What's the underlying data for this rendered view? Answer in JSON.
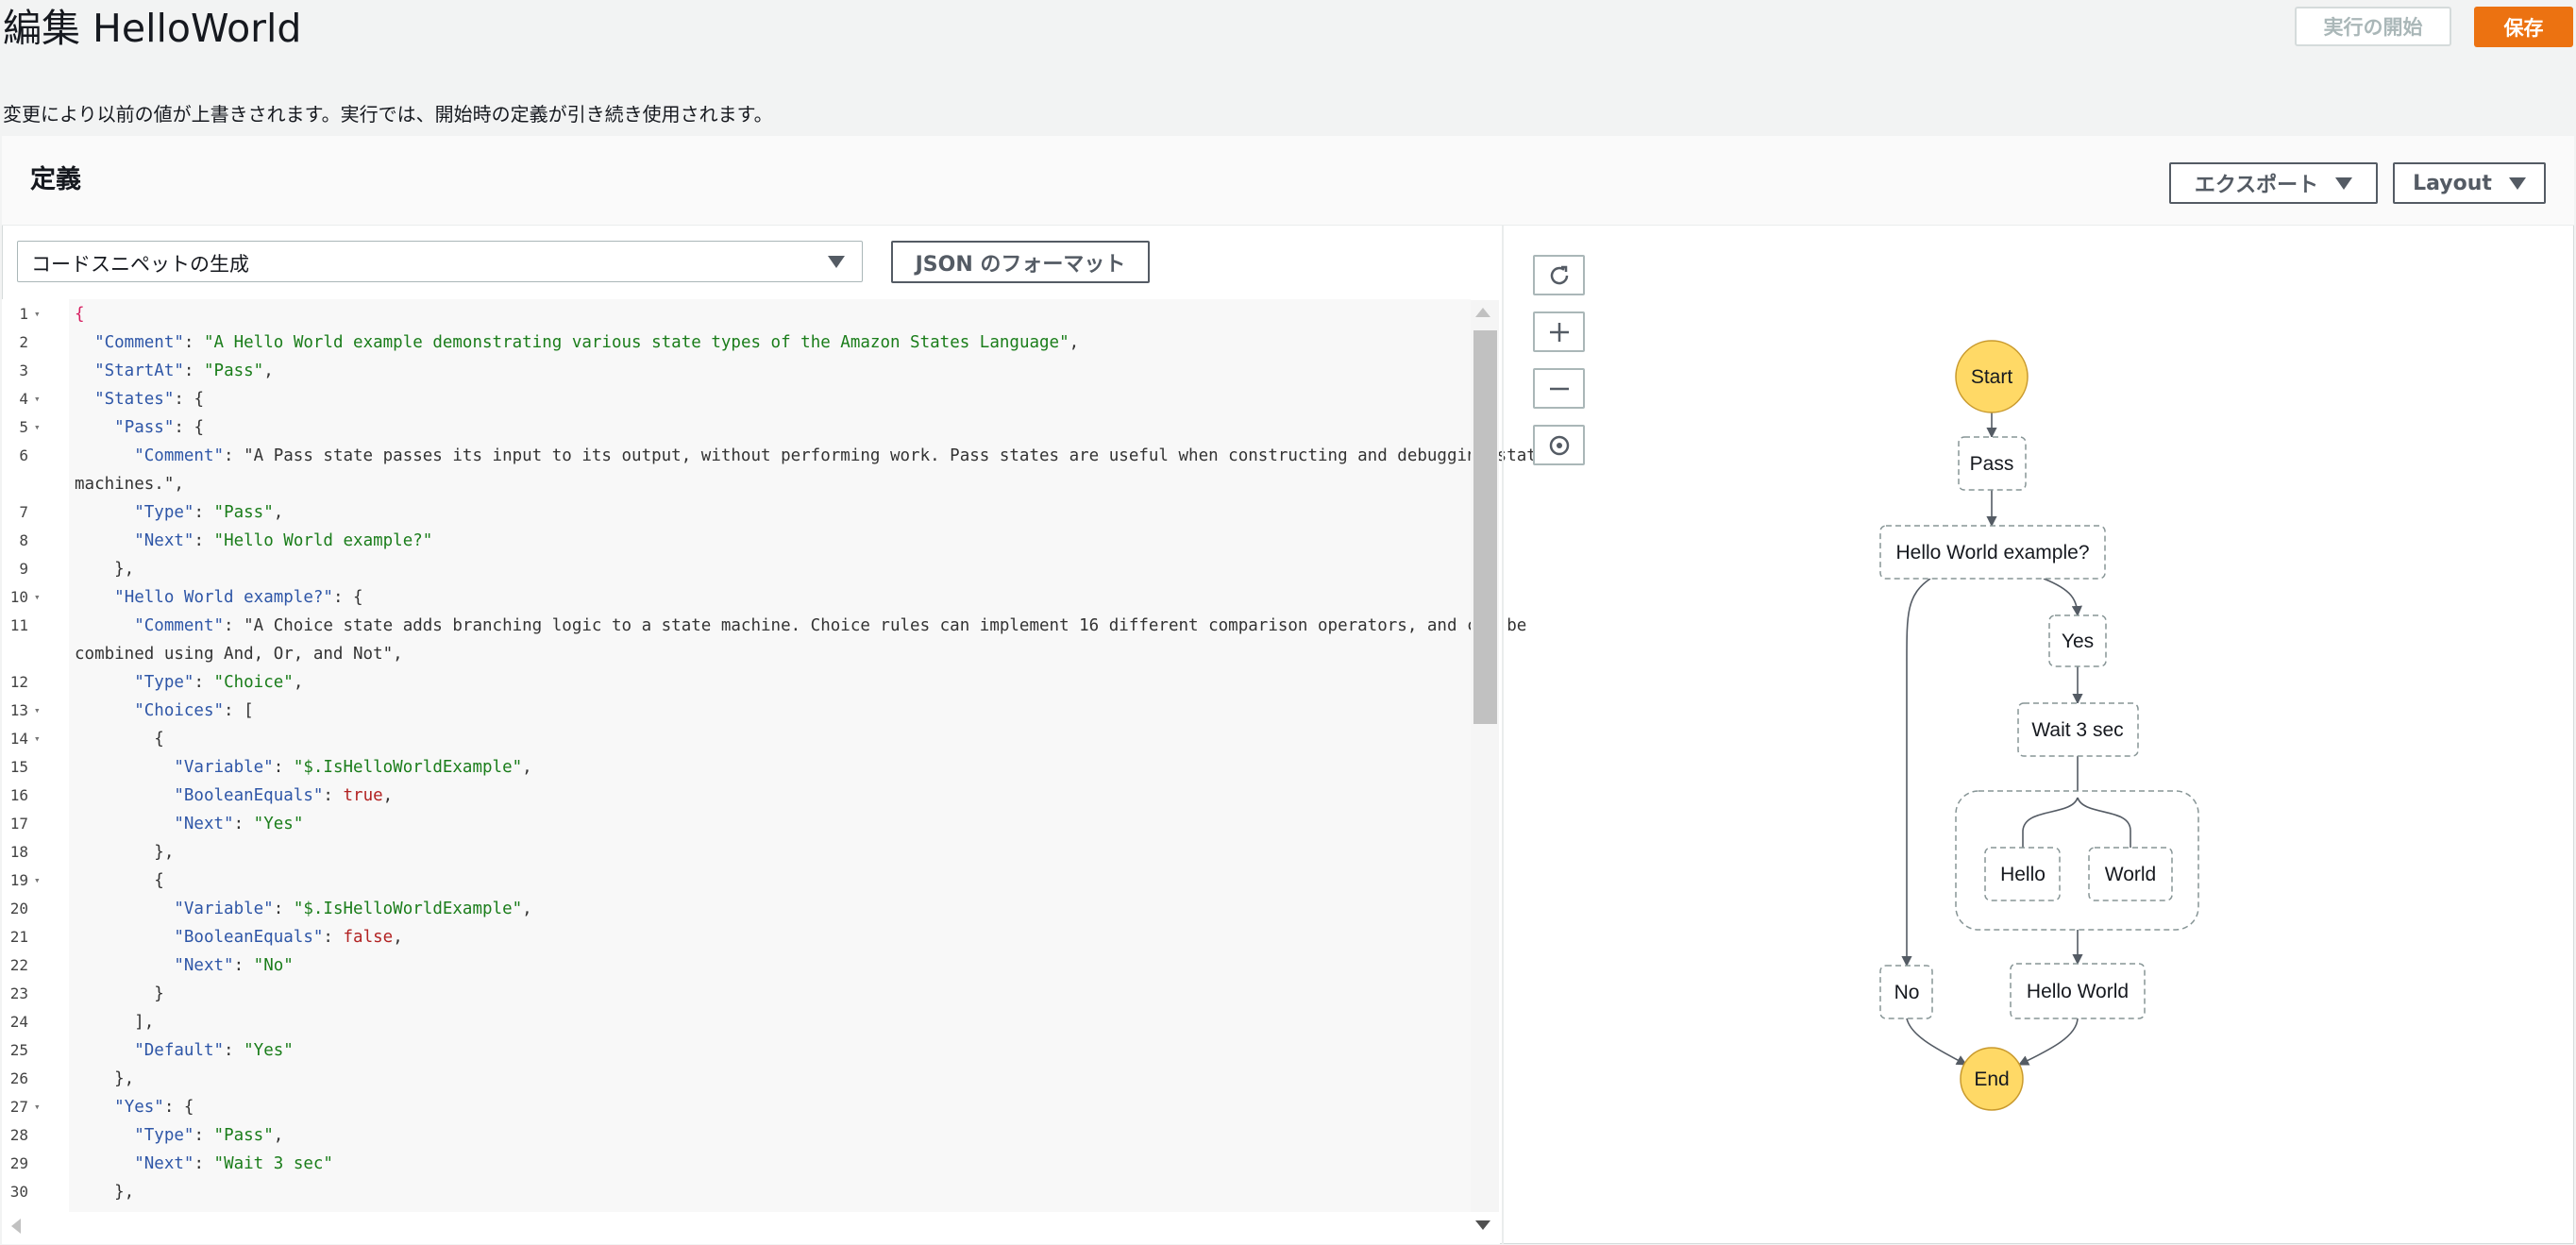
{
  "header": {
    "title": "編集 HelloWorld",
    "start_execution_label": "実行の開始",
    "save_label": "保存",
    "notice": "変更により以前の値が上書きされます。実行では、開始時の定義が引き続き使用されます。"
  },
  "panel": {
    "title": "定義",
    "export_label": "エクスポート",
    "layout_label": "Layout"
  },
  "editor": {
    "snippet_select_label": "コードスニペットの生成",
    "json_format_label": "JSON のフォーマット",
    "lines": [
      {
        "n": "1",
        "fold": true,
        "text": "{"
      },
      {
        "n": "2",
        "fold": false,
        "text": "  \"Comment\": \"A Hello World example demonstrating various state types of the Amazon States Language\","
      },
      {
        "n": "3",
        "fold": false,
        "text": "  \"StartAt\": \"Pass\","
      },
      {
        "n": "4",
        "fold": true,
        "text": "  \"States\": {"
      },
      {
        "n": "5",
        "fold": true,
        "text": "    \"Pass\": {"
      },
      {
        "n": "6",
        "fold": false,
        "text": "      \"Comment\": \"A Pass state passes its input to its output, without performing work. Pass states are useful when constructing and debugging state"
      },
      {
        "n": "",
        "fold": false,
        "text": "machines.\","
      },
      {
        "n": "7",
        "fold": false,
        "text": "      \"Type\": \"Pass\","
      },
      {
        "n": "8",
        "fold": false,
        "text": "      \"Next\": \"Hello World example?\""
      },
      {
        "n": "9",
        "fold": false,
        "text": "    },"
      },
      {
        "n": "10",
        "fold": true,
        "text": "    \"Hello World example?\": {"
      },
      {
        "n": "11",
        "fold": false,
        "text": "      \"Comment\": \"A Choice state adds branching logic to a state machine. Choice rules can implement 16 different comparison operators, and can be"
      },
      {
        "n": "",
        "fold": false,
        "text": "combined using And, Or, and Not\","
      },
      {
        "n": "12",
        "fold": false,
        "text": "      \"Type\": \"Choice\","
      },
      {
        "n": "13",
        "fold": true,
        "text": "      \"Choices\": ["
      },
      {
        "n": "14",
        "fold": true,
        "text": "        {"
      },
      {
        "n": "15",
        "fold": false,
        "text": "          \"Variable\": \"$.IsHelloWorldExample\","
      },
      {
        "n": "16",
        "fold": false,
        "text": "          \"BooleanEquals\": true,"
      },
      {
        "n": "17",
        "fold": false,
        "text": "          \"Next\": \"Yes\""
      },
      {
        "n": "18",
        "fold": false,
        "text": "        },"
      },
      {
        "n": "19",
        "fold": true,
        "text": "        {"
      },
      {
        "n": "20",
        "fold": false,
        "text": "          \"Variable\": \"$.IsHelloWorldExample\","
      },
      {
        "n": "21",
        "fold": false,
        "text": "          \"BooleanEquals\": false,"
      },
      {
        "n": "22",
        "fold": false,
        "text": "          \"Next\": \"No\""
      },
      {
        "n": "23",
        "fold": false,
        "text": "        }"
      },
      {
        "n": "24",
        "fold": false,
        "text": "      ],"
      },
      {
        "n": "25",
        "fold": false,
        "text": "      \"Default\": \"Yes\""
      },
      {
        "n": "26",
        "fold": false,
        "text": "    },"
      },
      {
        "n": "27",
        "fold": true,
        "text": "    \"Yes\": {"
      },
      {
        "n": "28",
        "fold": false,
        "text": "      \"Type\": \"Pass\","
      },
      {
        "n": "29",
        "fold": false,
        "text": "      \"Next\": \"Wait 3 sec\""
      },
      {
        "n": "30",
        "fold": false,
        "text": "    },"
      }
    ]
  },
  "graph": {
    "controls": [
      "refresh-icon",
      "zoom-in-icon",
      "zoom-out-icon",
      "center-icon"
    ],
    "nodes": {
      "start": "Start",
      "pass": "Pass",
      "choice": "Hello World example?",
      "yes": "Yes",
      "wait": "Wait 3 sec",
      "hello": "Hello",
      "world": "World",
      "no": "No",
      "hello_world": "Hello World",
      "end": "End"
    }
  },
  "colors": {
    "save_button": "#ec7211",
    "terminal_node": "#ffd966",
    "string": "#1a7d1a",
    "key": "#2e56a7",
    "boolean": "#b22222"
  }
}
